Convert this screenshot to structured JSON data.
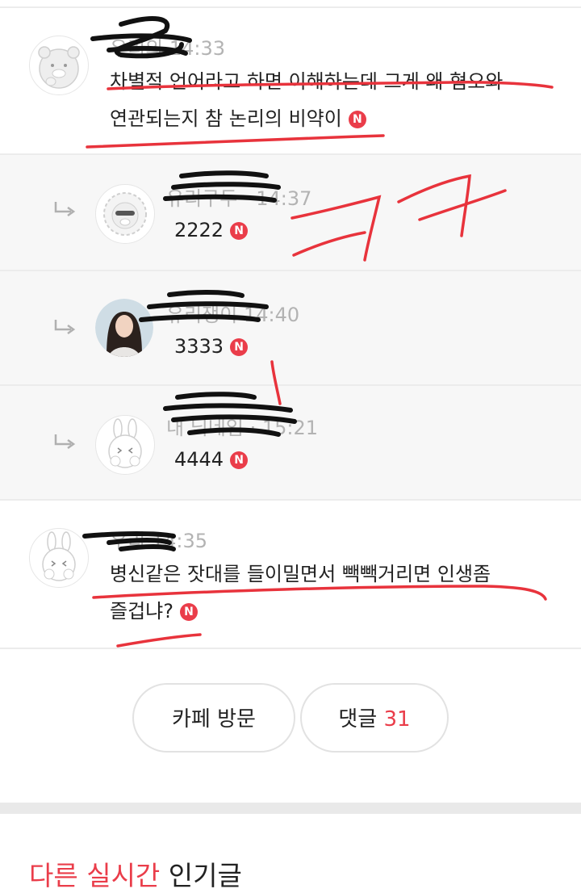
{
  "comments": [
    {
      "author": "우리의",
      "time": "14:33",
      "text_line1": "차별적 언어라고 하면 이해하는데 그게 왜 혐오와",
      "text_line2": "연관되는지 참 논리의 비약이",
      "badge": "N",
      "avatar_icon": "bear-character-icon"
    },
    {
      "author": "유리구두",
      "time": "14:37",
      "text": "2222",
      "badge": "N",
      "avatar_icon": "lion-character-icon"
    },
    {
      "author": "유리쟁이",
      "time": "14:40",
      "text": "3333",
      "badge": "N",
      "avatar_icon": "profile-photo-icon"
    },
    {
      "author": "내 닉네임",
      "time": "15:21",
      "text": "4444",
      "badge": "N",
      "avatar_icon": "rabbit-character-icon"
    },
    {
      "author": "우리",
      "time": "14:35",
      "text_line1": "병신같은 잣대를 들이밀면서 빽빽거리면 인생좀",
      "text_line2": "즐겁냐?",
      "badge": "N",
      "avatar_icon": "rabbit-character-icon"
    }
  ],
  "buttons": {
    "cafe_visit": "카페 방문",
    "comments_label": "댓글",
    "comments_count": "31"
  },
  "section": {
    "accent": "다른 실시간",
    "rest": " 인기글"
  },
  "colors": {
    "accent": "#ea3d4a",
    "annotation": "#e8333c",
    "scribble": "#111111"
  }
}
